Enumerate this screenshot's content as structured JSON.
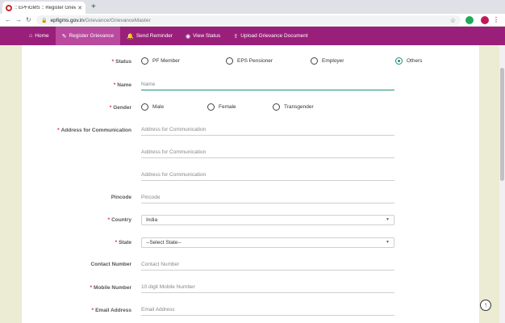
{
  "browser": {
    "tab_title": ":: EPFiGMS :: Register Grievan...",
    "url_domain": "epfigms.gov.in",
    "url_path": "/Grievance/GrievanceMaster"
  },
  "nav": [
    {
      "label": "Home",
      "icon": "home-icon"
    },
    {
      "label": "Register Grievance",
      "icon": "edit-icon"
    },
    {
      "label": "Send Reminder",
      "icon": "bell-icon"
    },
    {
      "label": "View Status",
      "icon": "eye-icon"
    },
    {
      "label": "Upload Grievance Document",
      "icon": "upload-icon"
    }
  ],
  "form": {
    "status": {
      "label": "Status",
      "options": [
        "PF Member",
        "EPS Pensioner",
        "Employer",
        "Others"
      ],
      "selected": "Others"
    },
    "name": {
      "label": "Name",
      "placeholder": "Name"
    },
    "gender": {
      "label": "Gender",
      "options": [
        "Male",
        "Female",
        "Transgender"
      ]
    },
    "address": {
      "label": "Address for Communication",
      "placeholders": [
        "Address for Communication",
        "Address for Communication",
        "Address for Communication"
      ]
    },
    "pincode": {
      "label": "Pincode",
      "placeholder": "Pincode"
    },
    "country": {
      "label": "Country",
      "value": "India"
    },
    "state": {
      "label": "State",
      "value": "--Select State--"
    },
    "contact": {
      "label": "Contact Number",
      "placeholder": "Contact Number"
    },
    "mobile": {
      "label": "Mobile Number",
      "placeholder": "10 digit Mobile Number"
    },
    "email": {
      "label": "Email Address",
      "placeholder": "Email Address"
    }
  },
  "colors": {
    "nav_bg": "#9a1f7a",
    "nav_active": "#b94a9e",
    "accent": "#1c8f7a",
    "required": "#d32f2f",
    "page_bg": "#ecebd3"
  }
}
